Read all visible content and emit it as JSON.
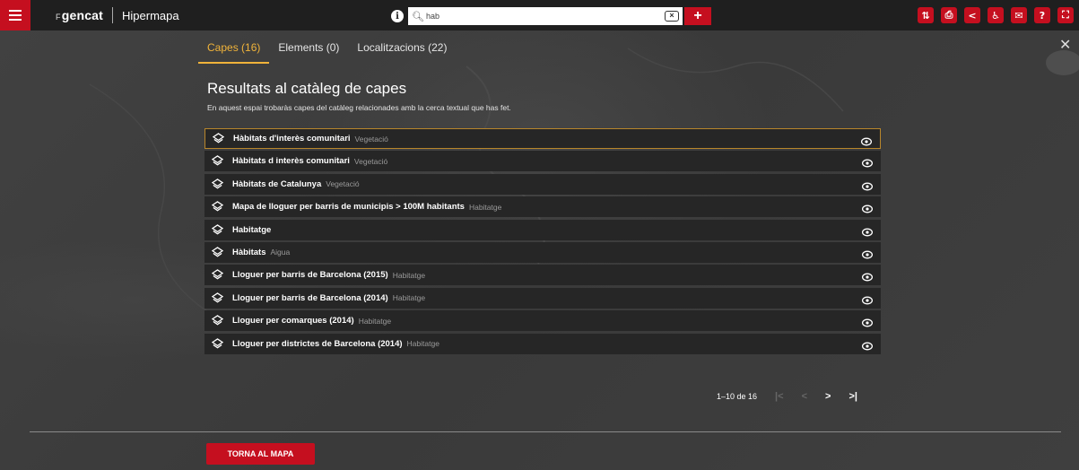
{
  "header": {
    "brand_prefix": "",
    "brand": "gencat",
    "app_title": "Hipermapa",
    "search_value": "hab",
    "add_label": "+",
    "tools": [
      {
        "icon": "sort-icon",
        "glyph": "⇅"
      },
      {
        "icon": "print-icon",
        "glyph": "⎙"
      },
      {
        "icon": "share-icon",
        "glyph": "<"
      },
      {
        "icon": "accessibility-icon",
        "glyph": "♿"
      },
      {
        "icon": "mail-icon",
        "glyph": "✉"
      },
      {
        "icon": "help-icon",
        "glyph": "?"
      },
      {
        "icon": "fullscreen-icon",
        "glyph": "⛶"
      }
    ]
  },
  "tabs": [
    {
      "label": "Capes (16)",
      "active": true
    },
    {
      "label": "Elements (0)",
      "active": false
    },
    {
      "label": "Localitzacions (22)",
      "active": false
    }
  ],
  "results": {
    "title": "Resultats al catàleg de capes",
    "subtitle": "En aquest espai trobaràs capes del catàleg relacionades amb la cerca textual que has fet.",
    "items": [
      {
        "name": "Hàbitats d'interès comunitari",
        "category": "Vegetació"
      },
      {
        "name": "Hàbitats d interès comunitari",
        "category": "Vegetació"
      },
      {
        "name": "Hàbitats de Catalunya",
        "category": "Vegetació"
      },
      {
        "name": "Mapa de lloguer per barris de municipis > 100M habitants",
        "category": "Habitatge"
      },
      {
        "name": "Habitatge",
        "category": ""
      },
      {
        "name": "Hàbitats",
        "category": "Aigua"
      },
      {
        "name": "Lloguer per barris de Barcelona (2015)",
        "category": "Habitatge"
      },
      {
        "name": "Lloguer per barris de Barcelona (2014)",
        "category": "Habitatge"
      },
      {
        "name": "Lloguer per comarques (2014)",
        "category": "Habitatge"
      },
      {
        "name": "Lloguer per districtes de Barcelona (2014)",
        "category": "Habitatge"
      }
    ]
  },
  "pager": {
    "range": "1–10 de 16",
    "first": "|<",
    "prev": "<",
    "next": ">",
    "last": ">|"
  },
  "back_button": "TORNA AL MAPA",
  "colors": {
    "accent_red": "#c50f1f",
    "active_tab": "#f0b33a",
    "row_bg": "#262626"
  }
}
